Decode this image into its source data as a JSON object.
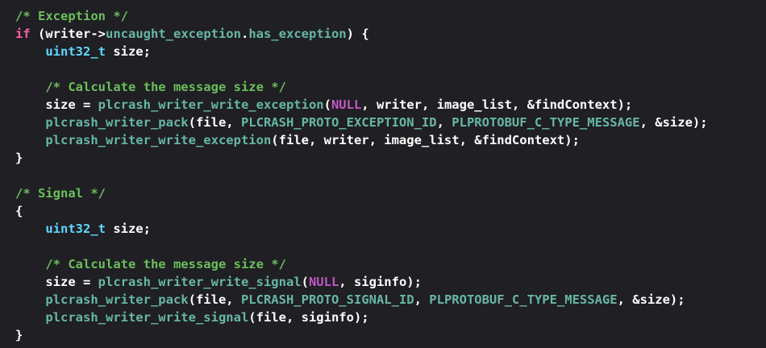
{
  "colors": {
    "background": "#1f1f24",
    "plain": "#ffffff",
    "comment": "#6bbf59",
    "keyword": "#fc5fa3",
    "macro": "#c158c3",
    "type": "#5dd8ff",
    "function": "#67b7a4"
  },
  "code": {
    "lines": [
      [
        {
          "k": "comment",
          "t": "/* Exception */"
        }
      ],
      [
        {
          "k": "keyword",
          "t": "if"
        },
        {
          "k": "plain",
          "t": " (writer->"
        },
        {
          "k": "member",
          "t": "uncaught_exception"
        },
        {
          "k": "plain",
          "t": "."
        },
        {
          "k": "member",
          "t": "has_exception"
        },
        {
          "k": "plain",
          "t": ") {"
        }
      ],
      [
        {
          "k": "plain",
          "t": "    "
        },
        {
          "k": "type",
          "t": "uint32_t"
        },
        {
          "k": "plain",
          "t": " size;"
        }
      ],
      [],
      [
        {
          "k": "plain",
          "t": "    "
        },
        {
          "k": "comment",
          "t": "/* Calculate the message size */"
        }
      ],
      [
        {
          "k": "plain",
          "t": "    size = "
        },
        {
          "k": "func",
          "t": "plcrash_writer_write_exception"
        },
        {
          "k": "plain",
          "t": "("
        },
        {
          "k": "macro",
          "t": "NULL"
        },
        {
          "k": "plain",
          "t": ", writer, image_list, &findContext);"
        }
      ],
      [
        {
          "k": "plain",
          "t": "    "
        },
        {
          "k": "func",
          "t": "plcrash_writer_pack"
        },
        {
          "k": "plain",
          "t": "(file, "
        },
        {
          "k": "const",
          "t": "PLCRASH_PROTO_EXCEPTION_ID"
        },
        {
          "k": "plain",
          "t": ", "
        },
        {
          "k": "const",
          "t": "PLPROTOBUF_C_TYPE_MESSAGE"
        },
        {
          "k": "plain",
          "t": ", &size);"
        }
      ],
      [
        {
          "k": "plain",
          "t": "    "
        },
        {
          "k": "func",
          "t": "plcrash_writer_write_exception"
        },
        {
          "k": "plain",
          "t": "(file, writer, image_list, &findContext);"
        }
      ],
      [
        {
          "k": "plain",
          "t": "}"
        }
      ],
      [],
      [
        {
          "k": "comment",
          "t": "/* Signal */"
        }
      ],
      [
        {
          "k": "plain",
          "t": "{"
        }
      ],
      [
        {
          "k": "plain",
          "t": "    "
        },
        {
          "k": "type",
          "t": "uint32_t"
        },
        {
          "k": "plain",
          "t": " size;"
        }
      ],
      [],
      [
        {
          "k": "plain",
          "t": "    "
        },
        {
          "k": "comment",
          "t": "/* Calculate the message size */"
        }
      ],
      [
        {
          "k": "plain",
          "t": "    size = "
        },
        {
          "k": "func",
          "t": "plcrash_writer_write_signal"
        },
        {
          "k": "plain",
          "t": "("
        },
        {
          "k": "macro",
          "t": "NULL"
        },
        {
          "k": "plain",
          "t": ", siginfo);"
        }
      ],
      [
        {
          "k": "plain",
          "t": "    "
        },
        {
          "k": "func",
          "t": "plcrash_writer_pack"
        },
        {
          "k": "plain",
          "t": "(file, "
        },
        {
          "k": "const",
          "t": "PLCRASH_PROTO_SIGNAL_ID"
        },
        {
          "k": "plain",
          "t": ", "
        },
        {
          "k": "const",
          "t": "PLPROTOBUF_C_TYPE_MESSAGE"
        },
        {
          "k": "plain",
          "t": ", &size);"
        }
      ],
      [
        {
          "k": "plain",
          "t": "    "
        },
        {
          "k": "func",
          "t": "plcrash_writer_write_signal"
        },
        {
          "k": "plain",
          "t": "(file, siginfo);"
        }
      ],
      [
        {
          "k": "plain",
          "t": "}"
        }
      ]
    ]
  }
}
